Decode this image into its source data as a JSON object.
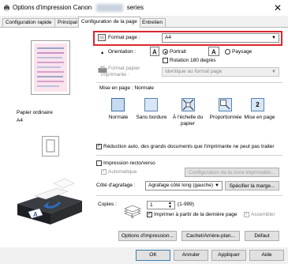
{
  "window": {
    "title_prefix": "Options d'impression Canon",
    "title_suffix": "series",
    "close_glyph": "✕"
  },
  "tabs": [
    {
      "label": "Configuration rapide"
    },
    {
      "label": "Principal"
    },
    {
      "label": "Configuration de la page"
    },
    {
      "label": "Entretien"
    }
  ],
  "active_tab": "Configuration de la page",
  "preview": {
    "paper_type_label": "Papier ordinaire",
    "paper_size_label": "A4"
  },
  "page_size": {
    "label": "Format page :",
    "value": "A4"
  },
  "orientation": {
    "label": "Orientation :",
    "portrait_label": "Portrait",
    "landscape_label": "Paysage",
    "selected": "Portrait",
    "rotate_label": "Rotation 180 degrés",
    "rotate_checked": false
  },
  "printer_paper": {
    "label_line1": "Format papier",
    "label_line2": "imprimante :",
    "value": "Identique au format page",
    "disabled": true
  },
  "layout": {
    "label": "Mise en page :",
    "value": "Normale",
    "options": [
      {
        "label": "Normale",
        "icon": "normal-layout-icon"
      },
      {
        "label": "Sans bordure",
        "icon": "borderless-layout-icon"
      },
      {
        "label": "À l'échelle du papier",
        "icon": "fit-to-page-icon"
      },
      {
        "label": "Proportionnée",
        "icon": "scaled-layout-icon"
      },
      {
        "label": "Mise en page",
        "icon": "page-layout-icon"
      }
    ],
    "page_layout_badge": "2"
  },
  "reduce_large": {
    "label": "Réduction auto. des grands documents que l'imprimante ne peut pas traiter",
    "checked": true
  },
  "duplex": {
    "label": "Impression recto/verso",
    "checked": false,
    "auto_label": "Automatique",
    "auto_checked": true,
    "print_area_button": "Configuration de la zone imprimable..."
  },
  "stapling": {
    "label": "Côté d'agrafage :",
    "value": "Agrafage côté long (gauche)",
    "margin_button": "Spécifier la marge..."
  },
  "copies": {
    "label": "Copies :",
    "value": "1",
    "range": "(1-999)",
    "last_page_label": "Imprimer à partir de la dernière page",
    "last_page_checked": true,
    "collate_label": "Assembler",
    "collate_checked": true
  },
  "buttons": {
    "print_options": "Options d'impression...",
    "stamp_background": "Cachet/Arrière-plan...",
    "defaults": "Défaut"
  },
  "footer": {
    "ok": "OK",
    "cancel": "Annuler",
    "apply": "Appliquer",
    "help": "Aide"
  },
  "colors": {
    "highlight": "#d9272e",
    "accent": "#3f6fa8"
  }
}
